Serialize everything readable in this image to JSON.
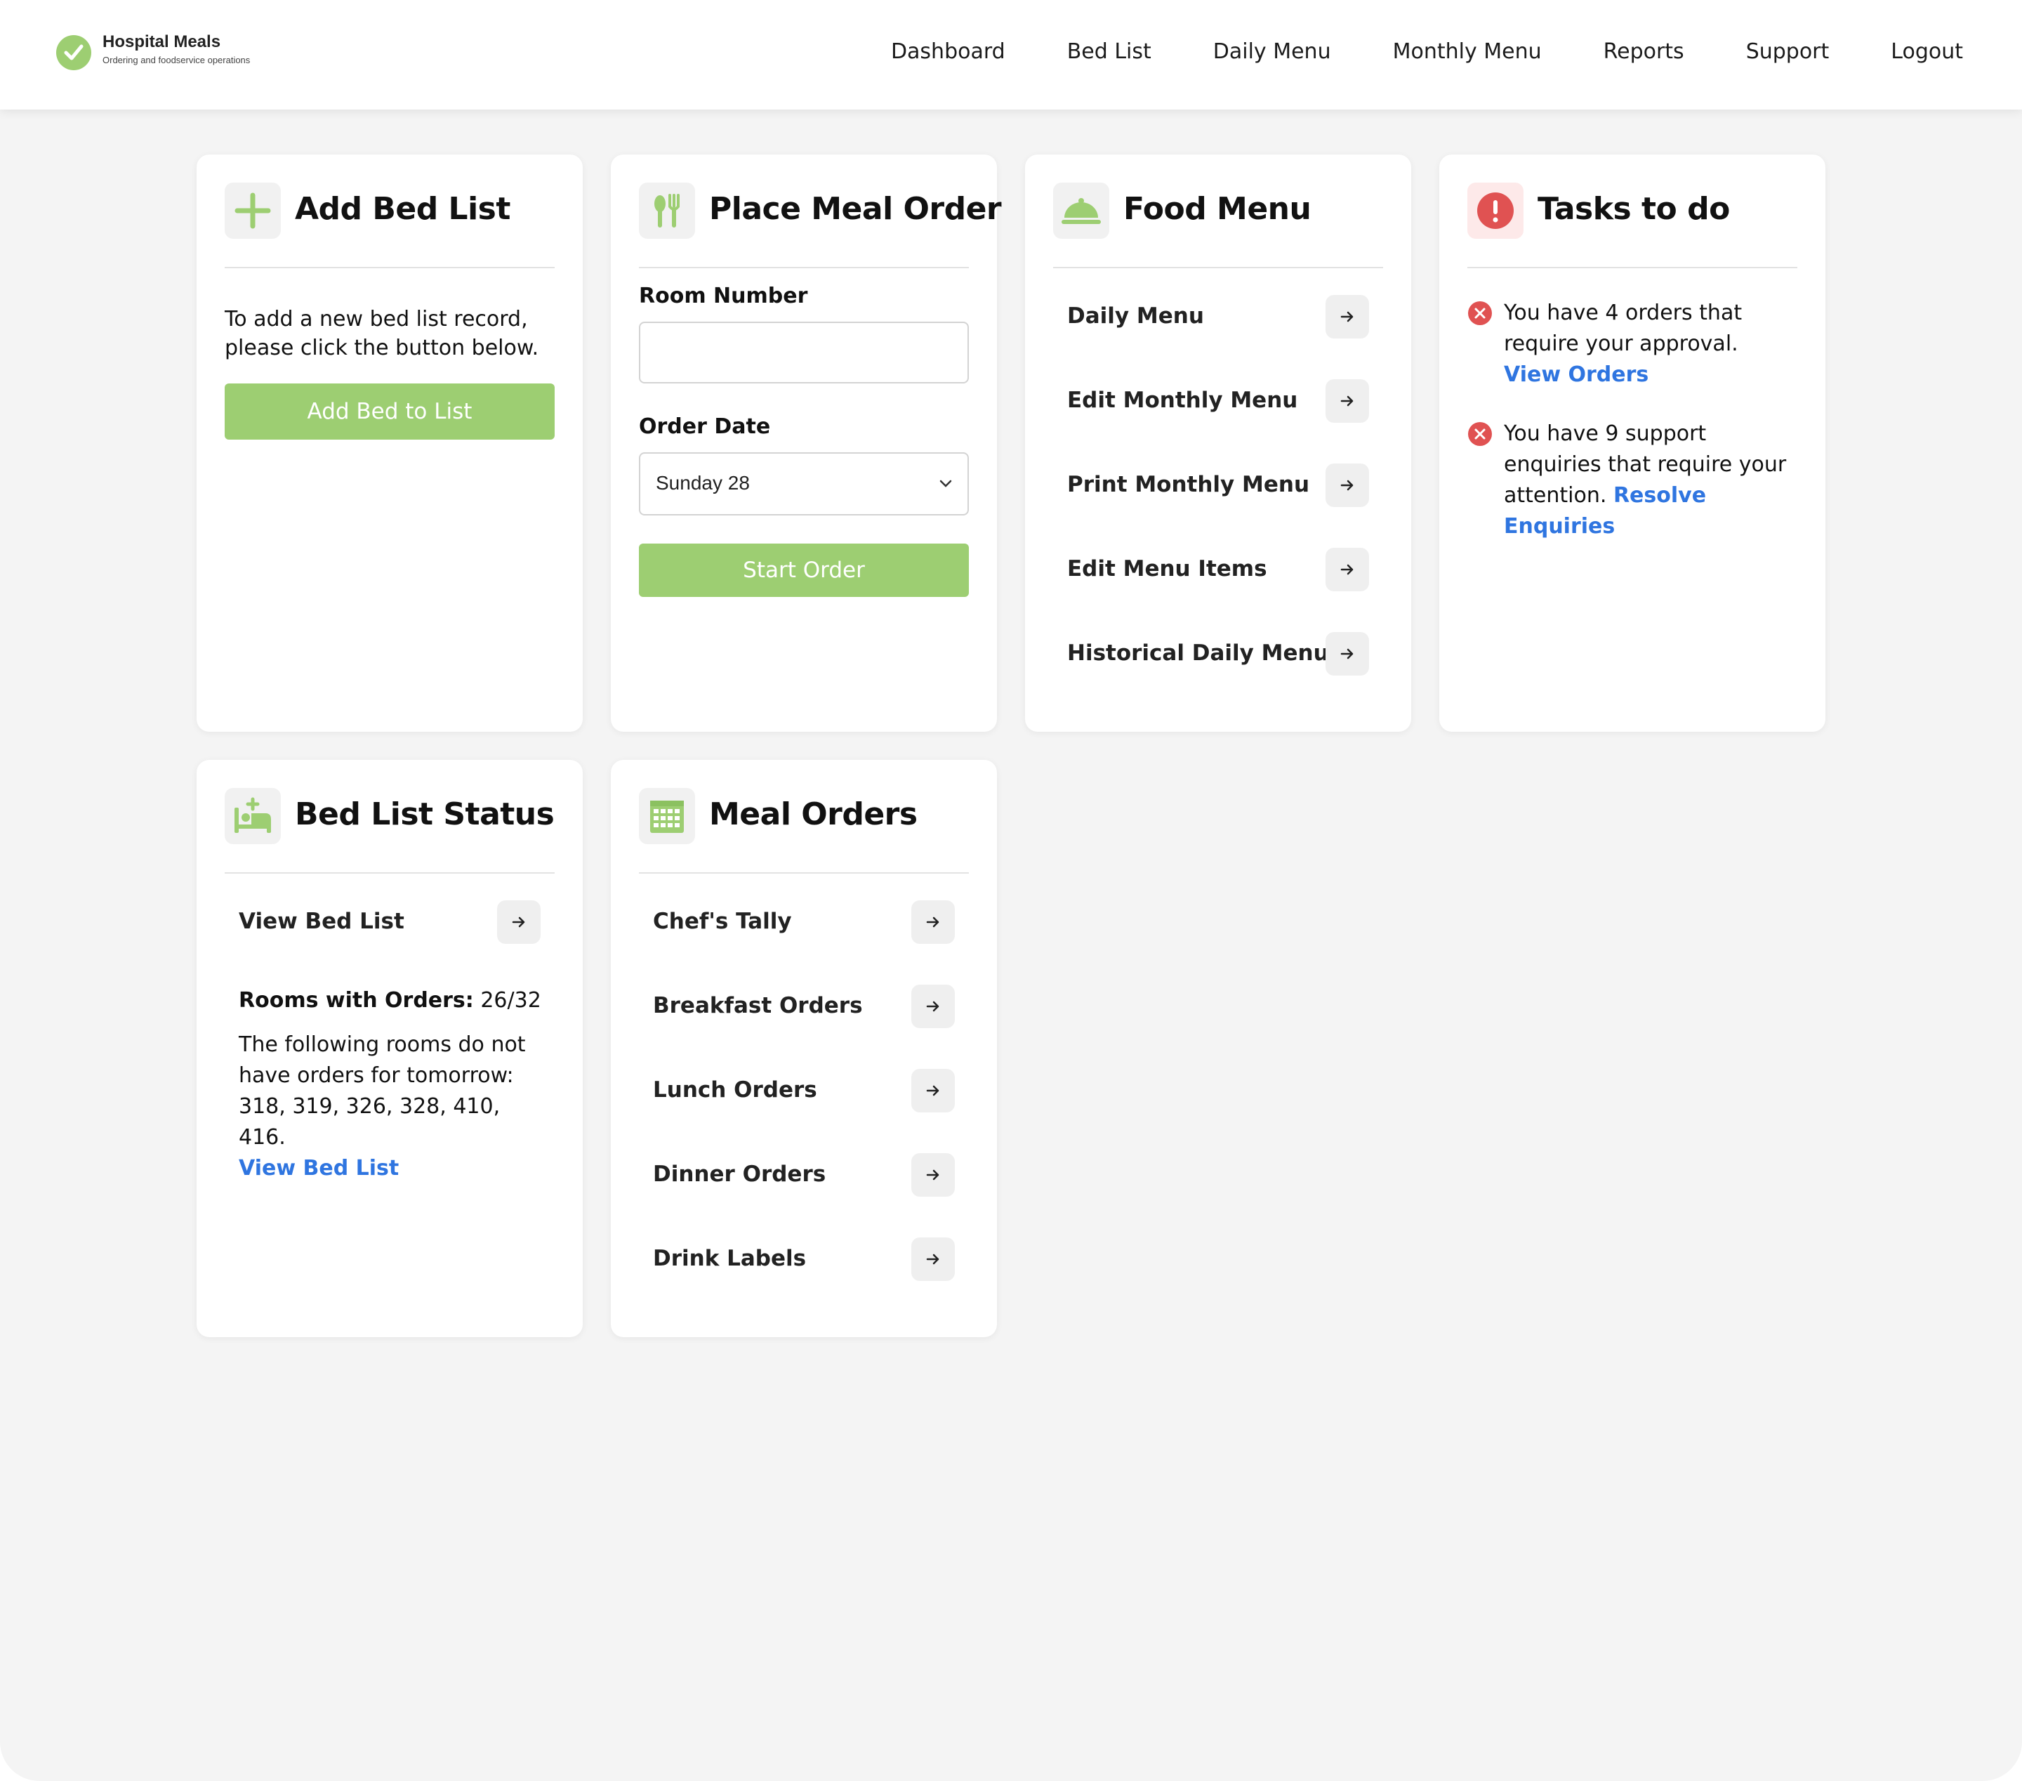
{
  "brand": {
    "title": "Hospital Meals",
    "subtitle": "Ordering and foodservice operations"
  },
  "nav": [
    "Dashboard",
    "Bed List",
    "Daily Menu",
    "Monthly Menu",
    "Reports",
    "Support",
    "Logout"
  ],
  "add_bed": {
    "title": "Add Bed List",
    "description": "To add a new bed list record, please click the button below.",
    "button": "Add Bed to List"
  },
  "meal_order": {
    "title": "Place Meal Order",
    "room_label": "Room Number",
    "room_value": "",
    "date_label": "Order Date",
    "date_value": "Sunday 28",
    "button": "Start Order"
  },
  "food_menu": {
    "title": "Food Menu",
    "items": [
      "Daily Menu",
      "Edit Monthly Menu",
      "Print Monthly Menu",
      "Edit Menu Items",
      "Historical Daily Menu"
    ]
  },
  "tasks": {
    "title": "Tasks to do",
    "items": [
      {
        "text": "You have 4 orders that require your approval.",
        "link": "View Orders"
      },
      {
        "text": "You have 9 support enquiries that require your attention.",
        "link": "Resolve Enquiries"
      }
    ]
  },
  "bed_status": {
    "title": "Bed List Status",
    "view_label": "View Bed List",
    "rooms_label": "Rooms with Orders:",
    "rooms_value": "26/32",
    "missing_text": "The following rooms do not have orders for tomorrow: 318, 319, 326, 328, 410, 416.",
    "link": "View Bed List"
  },
  "meal_orders": {
    "title": "Meal Orders",
    "items": [
      "Chef's Tally",
      "Breakfast Orders",
      "Lunch Orders",
      "Dinner Orders",
      "Drink Labels"
    ]
  },
  "colors": {
    "accent_green": "#9dce72",
    "link_blue": "#2f75e0",
    "alert_red": "#e05252",
    "background": "#f4f4f4"
  }
}
